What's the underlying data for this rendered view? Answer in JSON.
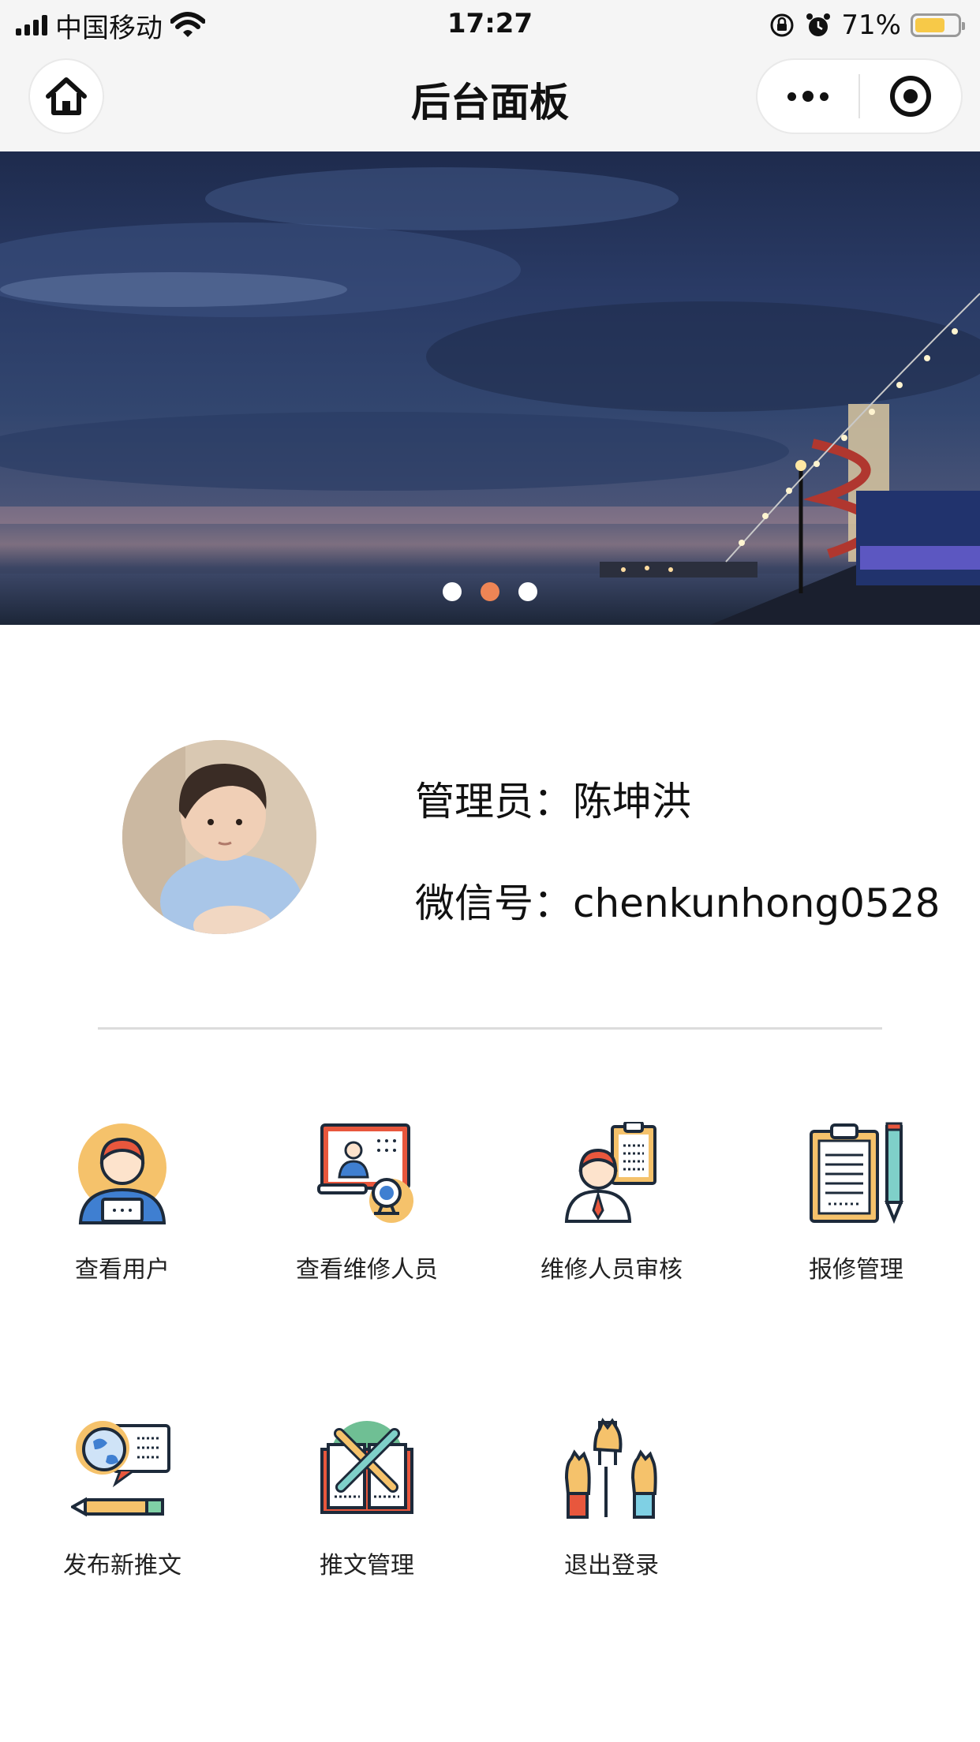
{
  "status_bar": {
    "carrier": "中国移动",
    "time": "17:27",
    "battery": "71%",
    "battery_level": 0.71
  },
  "nav": {
    "title": "后台面板",
    "home_icon": "home-icon",
    "more_icon": "more-icon",
    "close_icon": "target-icon"
  },
  "banner": {
    "slides": 3,
    "active_slide": 1
  },
  "profile": {
    "admin_label": "管理员：",
    "admin_name": "陈坤洪",
    "wechat_label": "微信号：",
    "wechat_id": "chenkunhong0528"
  },
  "menu": [
    {
      "label": "查看用户",
      "icon": "user-icon"
    },
    {
      "label": "查看维修人员",
      "icon": "technician-screen-icon"
    },
    {
      "label": "维修人员审核",
      "icon": "staff-review-icon"
    },
    {
      "label": "报修管理",
      "icon": "clipboard-pen-icon"
    },
    {
      "label": "发布新推文",
      "icon": "globe-publish-icon"
    },
    {
      "label": "推文管理",
      "icon": "book-tools-icon"
    },
    {
      "label": "退出登录",
      "icon": "raised-hands-icon"
    }
  ]
}
